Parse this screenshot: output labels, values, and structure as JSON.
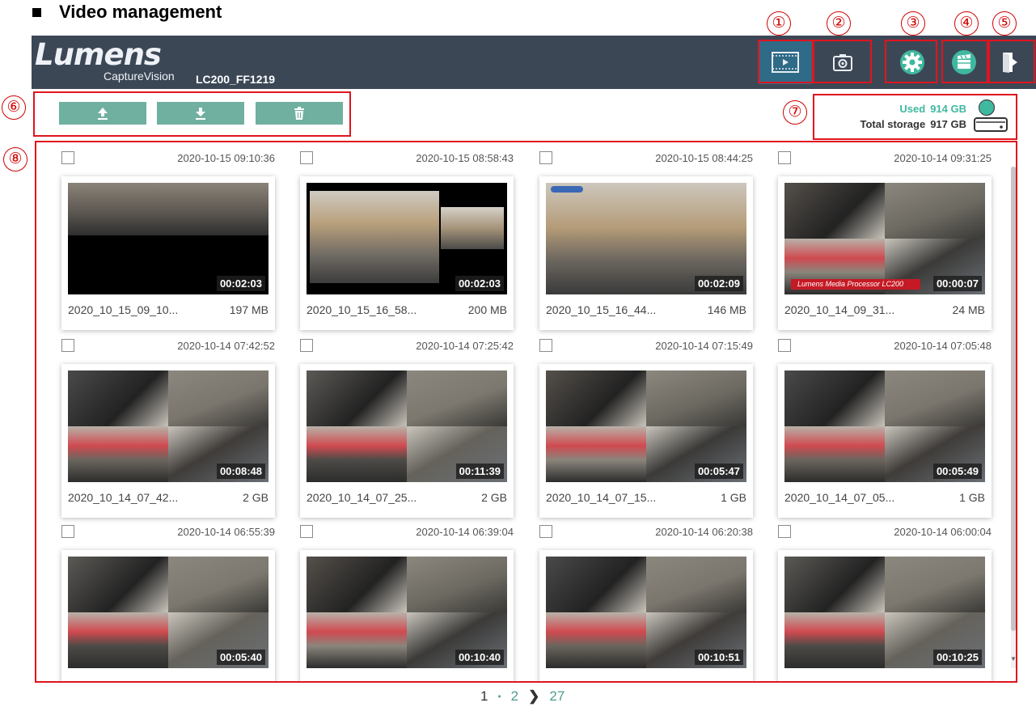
{
  "doc_heading": "Video management",
  "callouts": [
    "①",
    "②",
    "③",
    "④",
    "⑤",
    "⑥",
    "⑦",
    "⑧"
  ],
  "header": {
    "logo": "Lumens",
    "logo_sub": "CaptureVision",
    "device_name": "LC200_FF1219",
    "icons": [
      "video-management-icon",
      "snapshot-icon",
      "settings-icon",
      "recording-icon",
      "logout-icon"
    ],
    "active_color": "#2f6a87",
    "bar_color": "#3c4756"
  },
  "actions": {
    "icons": [
      "upload-icon",
      "download-icon",
      "delete-icon"
    ],
    "button_color": "#6fb0a0"
  },
  "storage": {
    "used_label": "Used",
    "used_value": "914 GB",
    "total_label": "Total storage",
    "total_value": "917 GB",
    "used_fraction": 0.997,
    "accent": "#3fb8a0"
  },
  "videos": [
    {
      "date": "2020-10-15  09:10:36",
      "duration": "00:02:03",
      "name": "2020_10_15_09_10...",
      "size": "197 MB",
      "thumb": "dual"
    },
    {
      "date": "2020-10-15  08:58:43",
      "duration": "00:02:03",
      "name": "2020_10_15_16_58...",
      "size": "200 MB",
      "thumb": "pip"
    },
    {
      "date": "2020-10-15  08:44:25",
      "duration": "00:02:09",
      "name": "2020_10_15_16_44...",
      "size": "146 MB",
      "thumb": "single"
    },
    {
      "date": "2020-10-14  09:31:25",
      "duration": "00:00:07",
      "name": "2020_10_14_09_31...",
      "size": "24 MB",
      "thumb": "quad-banner"
    },
    {
      "date": "2020-10-14  07:42:52",
      "duration": "00:08:48",
      "name": "2020_10_14_07_42...",
      "size": "2 GB",
      "thumb": "quad"
    },
    {
      "date": "2020-10-14  07:25:42",
      "duration": "00:11:39",
      "name": "2020_10_14_07_25...",
      "size": "2 GB",
      "thumb": "quad"
    },
    {
      "date": "2020-10-14  07:15:49",
      "duration": "00:05:47",
      "name": "2020_10_14_07_15...",
      "size": "1 GB",
      "thumb": "quad"
    },
    {
      "date": "2020-10-14  07:05:48",
      "duration": "00:05:49",
      "name": "2020_10_14_07_05...",
      "size": "1 GB",
      "thumb": "quad"
    },
    {
      "date": "2020-10-14  06:55:39",
      "duration": "00:05:40",
      "name": "",
      "size": "",
      "thumb": "quad"
    },
    {
      "date": "2020-10-14  06:39:04",
      "duration": "00:10:40",
      "name": "",
      "size": "",
      "thumb": "quad"
    },
    {
      "date": "2020-10-14  06:20:38",
      "duration": "00:10:51",
      "name": "",
      "size": "",
      "thumb": "quad"
    },
    {
      "date": "2020-10-14  06:00:04",
      "duration": "00:10:25",
      "name": "",
      "size": "",
      "thumb": "quad"
    }
  ],
  "banner_text": "Lumens Media Processor LC200",
  "pagination": {
    "current": "1",
    "next_page": "2",
    "last": "27"
  },
  "highlight_color": "#e0141e"
}
